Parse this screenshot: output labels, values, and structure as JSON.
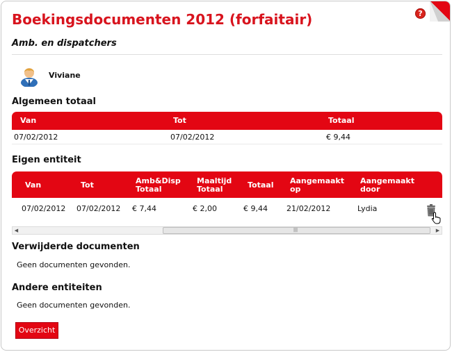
{
  "header": {
    "title": "Boekingsdocumenten 2012 (forfaitair)",
    "subtitle": "Amb. en dispatchers",
    "help_icon": "help-icon"
  },
  "user": {
    "name": "Viviane"
  },
  "algemeen": {
    "title": "Algemeen totaal",
    "columns": [
      "Van",
      "Tot",
      "Totaal"
    ],
    "rows": [
      [
        "07/02/2012",
        "07/02/2012",
        "€ 9,44"
      ]
    ]
  },
  "eigen": {
    "title": "Eigen entiteit",
    "columns": [
      {
        "l1": "Van",
        "l2": ""
      },
      {
        "l1": "Tot",
        "l2": ""
      },
      {
        "l1": "Amb&Disp",
        "l2": "Totaal"
      },
      {
        "l1": "Maaltijd",
        "l2": "Totaal"
      },
      {
        "l1": "Totaal",
        "l2": ""
      },
      {
        "l1": "Aangemaakt",
        "l2": "op"
      },
      {
        "l1": "Aangemaakt",
        "l2": "door"
      }
    ],
    "rows": [
      [
        "07/02/2012",
        "07/02/2012",
        "€ 7,44",
        "€ 2,00",
        "€ 9,44",
        "21/02/2012",
        "Lydia"
      ]
    ]
  },
  "verwijderde": {
    "title": "Verwijderde documenten",
    "empty": "Geen documenten gevonden."
  },
  "andere": {
    "title": "Andere entiteiten",
    "empty": "Geen documenten gevonden."
  },
  "actions": {
    "overzicht": "Overzicht"
  },
  "colors": {
    "accent": "#e30613",
    "title": "#d8141e"
  }
}
